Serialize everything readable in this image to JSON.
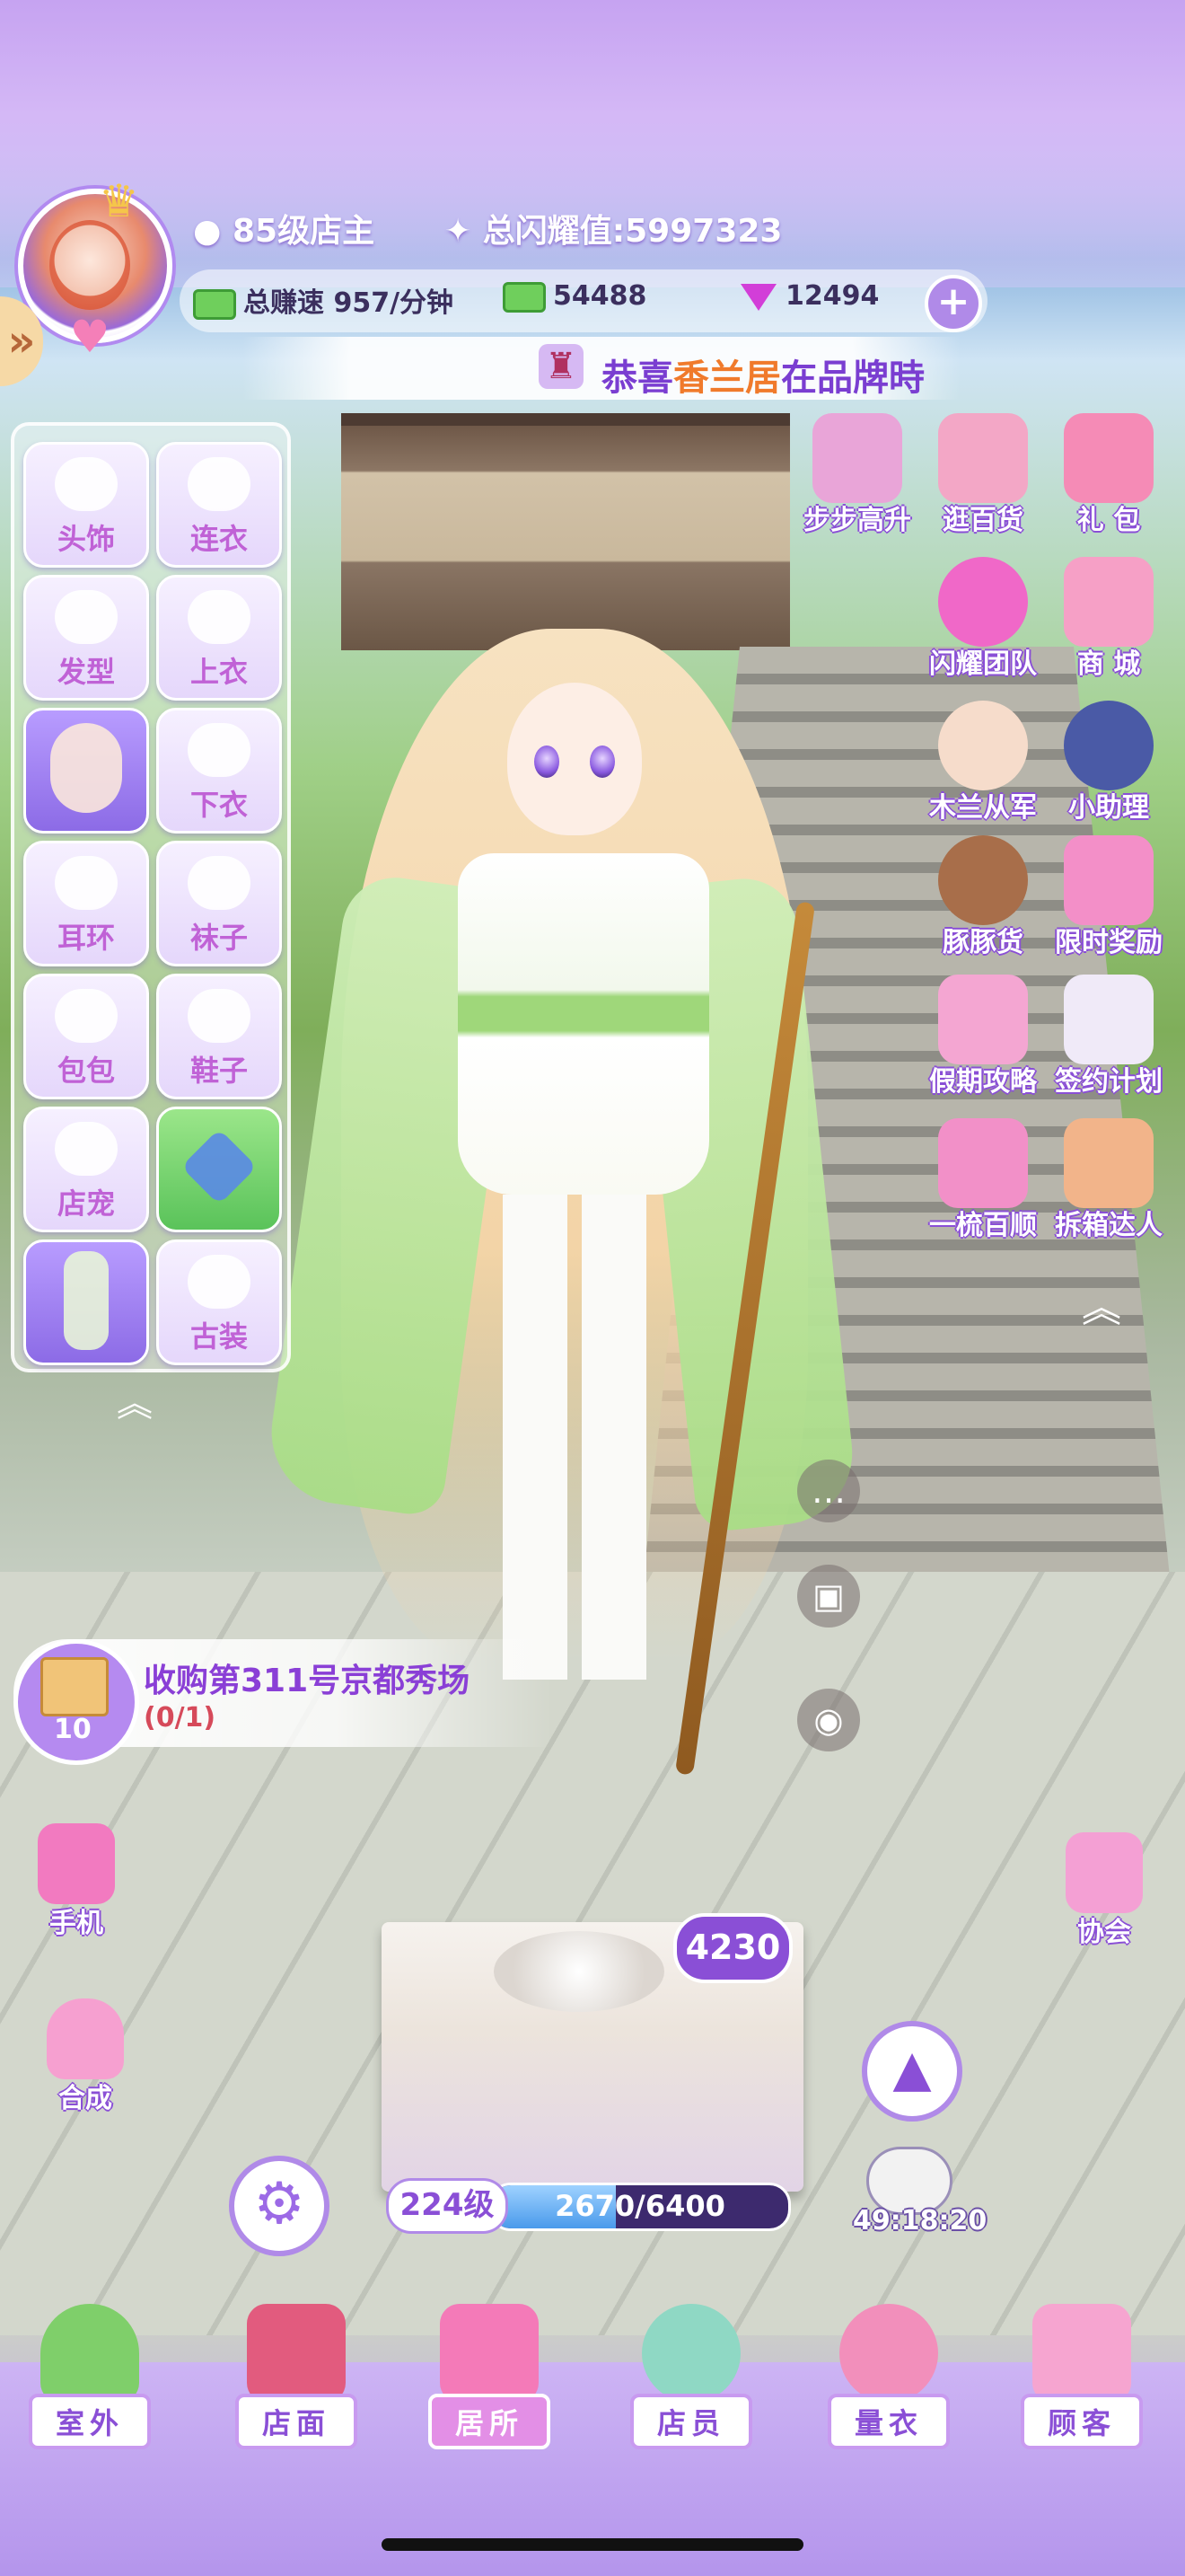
{
  "player": {
    "level": "85级店主",
    "glow_label": "总闪耀值:",
    "glow_value": "5997323",
    "earn_rate": "总赚速 957/分钟",
    "cash": "54488",
    "gems": "12494"
  },
  "banner": {
    "prefix": "恭喜",
    "highlight": "香兰居",
    "suffix": "在品牌時"
  },
  "wardrobe": {
    "slots": [
      {
        "label": "头饰"
      },
      {
        "label": "连衣"
      },
      {
        "label": "发型"
      },
      {
        "label": "上衣"
      },
      {
        "label": ""
      },
      {
        "label": "下衣"
      },
      {
        "label": "耳环"
      },
      {
        "label": "袜子"
      },
      {
        "label": "包包"
      },
      {
        "label": "鞋子"
      },
      {
        "label": "店宠"
      },
      {
        "label": ""
      },
      {
        "label": ""
      },
      {
        "label": "古装"
      }
    ]
  },
  "right_menu": [
    {
      "label": "步步高升",
      "icon": "stairs-runner-icon"
    },
    {
      "label": "逛百货",
      "icon": "store-icon"
    },
    {
      "label": "礼 包",
      "icon": "gift-icon"
    },
    {
      "label": "闪耀团队",
      "icon": "heart-crown-icon"
    },
    {
      "label": "商 城",
      "icon": "shop-icon"
    },
    {
      "label": "木兰从军",
      "icon": "mulan-icon"
    },
    {
      "label": "小助理",
      "icon": "assistant-icon"
    },
    {
      "label": "豚豚货",
      "icon": "capybara-icon"
    },
    {
      "label": "限时奖励",
      "icon": "reward-box-icon"
    },
    {
      "label": "假期攻略",
      "icon": "map-pin-icon"
    },
    {
      "label": "签约计划",
      "icon": "contract-icon"
    },
    {
      "label": "一梳百顺",
      "icon": "comb-icon"
    },
    {
      "label": "拆箱达人",
      "icon": "boxes-icon"
    }
  ],
  "quest": {
    "title": "收购第311号京都秀场",
    "progress": "(0/1)",
    "badge": "10"
  },
  "left_buttons": [
    {
      "label": "手机",
      "icon": "phone-icon"
    },
    {
      "label": "合成",
      "icon": "bag-icon"
    }
  ],
  "association": {
    "label": "协会"
  },
  "gift": {
    "count": "4230"
  },
  "level_bar": {
    "level": "224级",
    "xp": "2670/6400",
    "fraction": 0.417
  },
  "timer": "49:18:20",
  "nav": [
    {
      "label": "室外"
    },
    {
      "label": "店面"
    },
    {
      "label": "居所",
      "active": true
    },
    {
      "label": "店员"
    },
    {
      "label": "量衣"
    },
    {
      "label": "顾客"
    }
  ],
  "colors": {
    "accent": "#8a4fd6",
    "nav_bg": "#b495ec",
    "highlight_orange": "#f07a2b"
  }
}
